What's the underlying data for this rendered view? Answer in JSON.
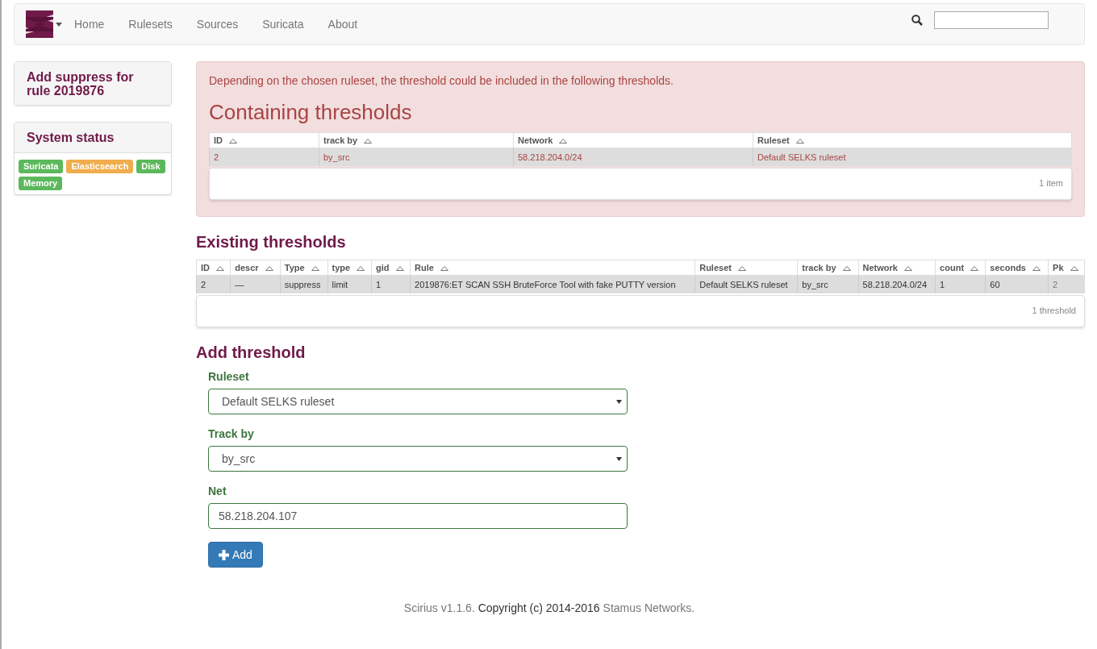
{
  "navbar": {
    "menu": [
      "Home",
      "Rulesets",
      "Sources",
      "Suricata",
      "About"
    ]
  },
  "sidebar": {
    "title": "Add suppress for rule 2019876",
    "status_title": "System status",
    "status": [
      {
        "label": "Suricata",
        "color": "#5cb85c"
      },
      {
        "label": "Elasticsearch",
        "color": "#f0ad4e"
      },
      {
        "label": "Disk",
        "color": "#5cb85c"
      },
      {
        "label": "Memory",
        "color": "#5cb85c"
      }
    ]
  },
  "alert": {
    "message": "Depending on the chosen ruleset, the threshold could be included in the following thresholds.",
    "title": "Containing thresholds",
    "table": {
      "columns": [
        "ID",
        "track by",
        "Network",
        "Ruleset"
      ],
      "rows": [
        {
          "cells": [
            "2",
            "by_src",
            "58.218.204.0/24",
            "Default SELKS ruleset"
          ],
          "selected": true
        }
      ],
      "footer": "1 item"
    }
  },
  "existing": {
    "title": "Existing thresholds",
    "table": {
      "columns": [
        "ID",
        "descr",
        "Type",
        "type",
        "gid",
        "Rule",
        "Ruleset",
        "track by",
        "Network",
        "count",
        "seconds",
        "Pk"
      ],
      "rows": [
        {
          "cells": [
            "2",
            "—",
            "suppress",
            "limit",
            "1",
            "2019876:ET SCAN SSH BruteForce Tool with fake PUTTY version",
            "Default SELKS ruleset",
            "by_src",
            "58.218.204.0/24",
            "1",
            "60",
            "2"
          ],
          "selected": true
        }
      ],
      "footer": "1 threshold"
    }
  },
  "form": {
    "title": "Add threshold",
    "fields": [
      {
        "kind": "select",
        "label": "Ruleset",
        "value": "Default SELKS ruleset"
      },
      {
        "kind": "select",
        "label": "Track by",
        "value": "by_src"
      },
      {
        "kind": "input",
        "label": "Net",
        "value": "58.218.204.107"
      }
    ],
    "button": "Add"
  },
  "footer": [
    {
      "kind": "link",
      "text": "Scirius v1.1.6."
    },
    {
      "kind": "text",
      "text": "Copyright (c) 2014-2016"
    },
    {
      "kind": "link",
      "text": "Stamus Networks."
    }
  ]
}
